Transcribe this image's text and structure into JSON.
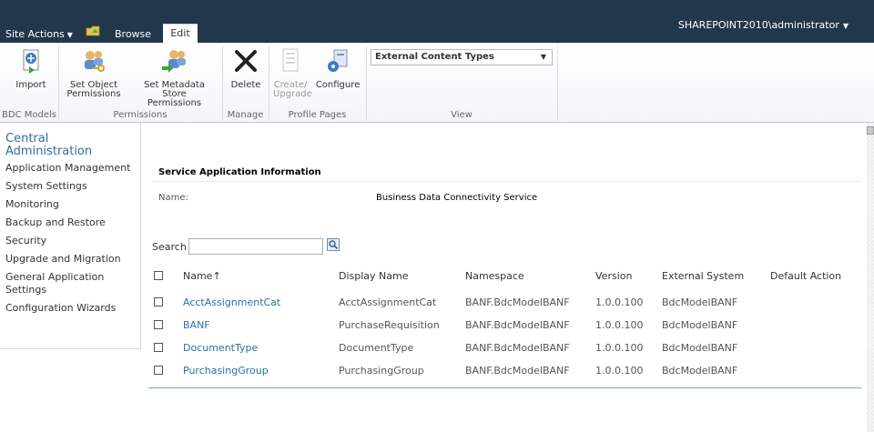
{
  "topbar": {
    "site_actions": "Site Actions",
    "browse_tab": "Browse",
    "edit_tab": "Edit",
    "user": "SHAREPOINT2010\\administrator"
  },
  "ribbon": {
    "buttons": {
      "import": "Import",
      "set_object_permissions_1": "Set Object",
      "set_object_permissions_2": "Permissions",
      "set_metadata_permissions_1": "Set Metadata Store",
      "set_metadata_permissions_2": "Permissions",
      "delete": "Delete",
      "create_upgrade_1": "Create/",
      "create_upgrade_2": "Upgrade",
      "configure": "Configure"
    },
    "groups": {
      "bdc_models": "BDC Models",
      "permissions": "Permissions",
      "manage": "Manage",
      "profile_pages": "Profile Pages",
      "view": "View"
    },
    "view_select": "External Content Types"
  },
  "leftnav": {
    "central_admin_1": "Central",
    "central_admin_2": "Administration",
    "items": [
      "Application Management",
      "System Settings",
      "Monitoring",
      "Backup and Restore",
      "Security",
      "Upgrade and Migration",
      "General Application",
      "Settings",
      "Configuration Wizards"
    ]
  },
  "main": {
    "section_title": "Service Application Information",
    "name_label": "Name:",
    "name_value": "Business Data Connectivity Service",
    "search_label": "Search",
    "search_value": ""
  },
  "table": {
    "headers": {
      "name": "Name",
      "name_sort": "↑",
      "display_name": "Display Name",
      "namespace": "Namespace",
      "version": "Version",
      "external_system": "External System",
      "default_action": "Default Action"
    },
    "rows": [
      {
        "name": "AcctAssignmentCat",
        "display_name": "AcctAssignmentCat",
        "namespace": "BANF.BdcModelBANF",
        "version": "1.0.0.100",
        "external_system": "BdcModelBANF"
      },
      {
        "name": "BANF",
        "display_name": "PurchaseRequisition",
        "namespace": "BANF.BdcModelBANF",
        "version": "1.0.0.100",
        "external_system": "BdcModelBANF"
      },
      {
        "name": "DocumentType",
        "display_name": "DocumentType",
        "namespace": "BANF.BdcModelBANF",
        "version": "1.0.0.100",
        "external_system": "BdcModelBANF"
      },
      {
        "name": "PurchasingGroup",
        "display_name": "PurchasingGroup",
        "namespace": "BANF.BdcModelBANF",
        "version": "1.0.0.100",
        "external_system": "BdcModelBANF"
      }
    ]
  },
  "colors": {
    "topbar_bg": "#21374c",
    "link": "#2e6ea1",
    "table_rule": "#6fa7d3"
  }
}
